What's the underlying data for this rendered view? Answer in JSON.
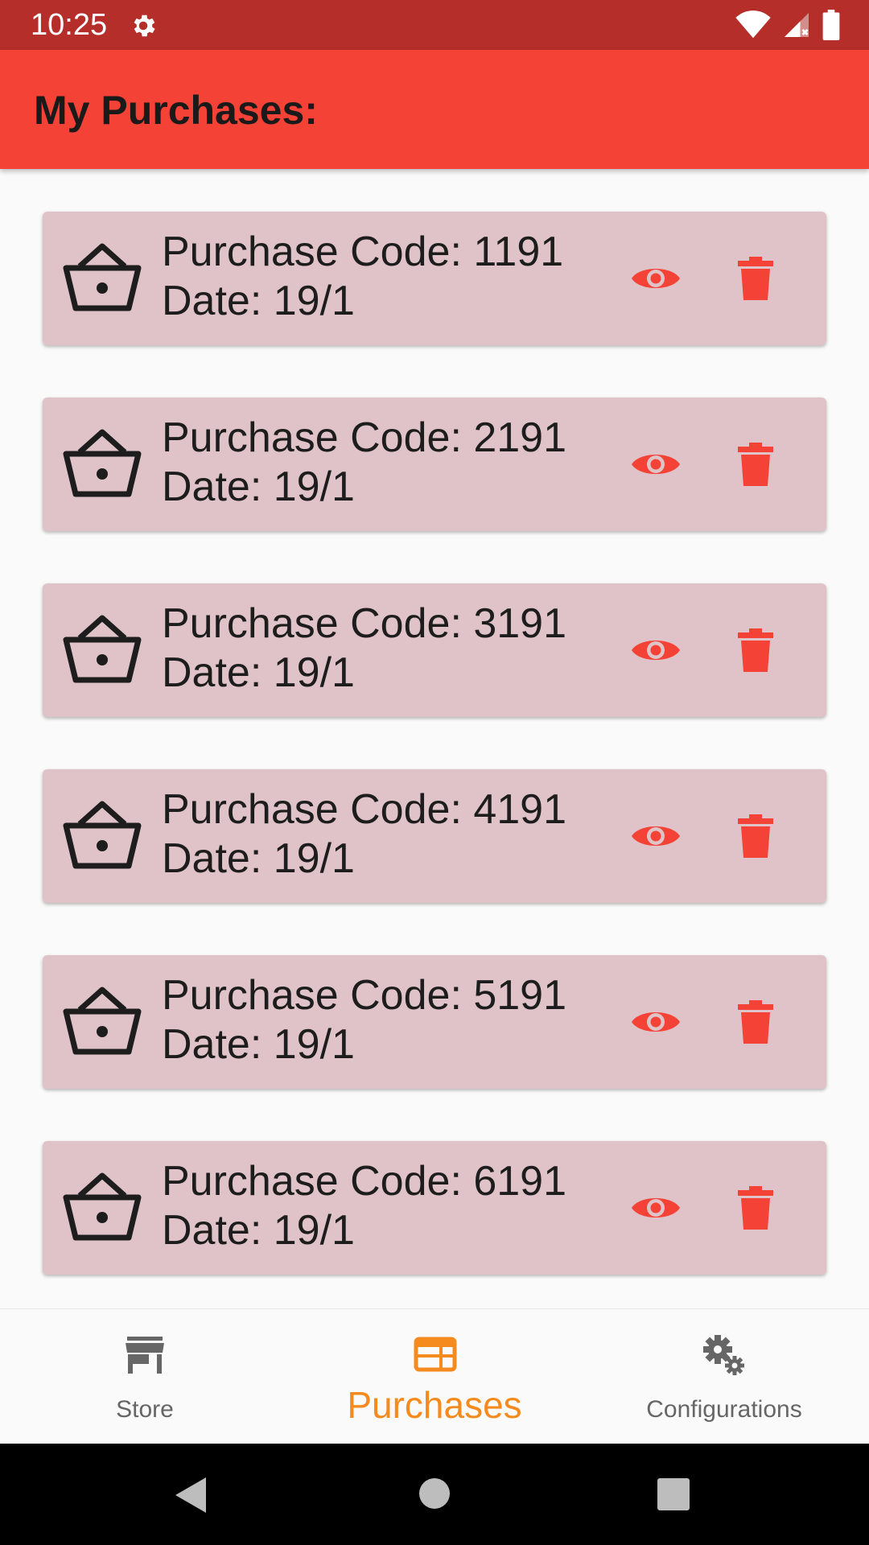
{
  "status_bar": {
    "time": "10:25",
    "icons": [
      "gear-icon",
      "wifi-icon",
      "signal-icon",
      "battery-icon"
    ]
  },
  "app_bar": {
    "title": "My Purchases:"
  },
  "purchases": [
    {
      "code": "Purchase Code: 1191",
      "date": "Date: 19/1"
    },
    {
      "code": "Purchase Code: 2191",
      "date": "Date: 19/1"
    },
    {
      "code": "Purchase Code: 3191",
      "date": "Date: 19/1"
    },
    {
      "code": "Purchase Code: 4191",
      "date": "Date: 19/1"
    },
    {
      "code": "Purchase Code: 5191",
      "date": "Date: 19/1"
    },
    {
      "code": "Purchase Code: 6191",
      "date": "Date: 19/1"
    }
  ],
  "bottom_nav": {
    "items": [
      {
        "label": "Store",
        "icon": "store-icon",
        "selected": false
      },
      {
        "label": "Purchases",
        "icon": "purchases-icon",
        "selected": true
      },
      {
        "label": "Configurations",
        "icon": "gears-icon",
        "selected": false
      }
    ]
  },
  "colors": {
    "status_bar": "#b52e2a",
    "app_bar": "#f44336",
    "card": "#e0c3c8",
    "action_red": "#f44336",
    "nav_selected": "#f58a1f",
    "nav_unselected": "#666666"
  }
}
